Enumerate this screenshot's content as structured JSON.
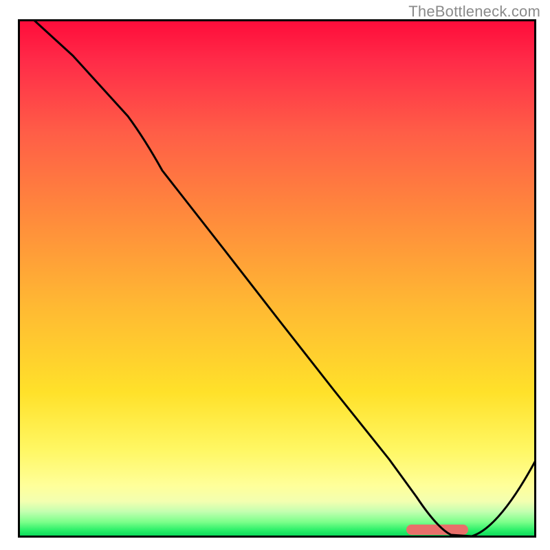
{
  "watermark": "TheBottleneck.com",
  "chart_data": {
    "type": "line",
    "title": "",
    "xlabel": "",
    "ylabel": "",
    "xlim": [
      0,
      100
    ],
    "ylim": [
      0,
      100
    ],
    "series": [
      {
        "name": "curve",
        "x": [
          3,
          10,
          20,
          25,
          30,
          40,
          50,
          60,
          70,
          75,
          80,
          83,
          87,
          100
        ],
        "values": [
          100,
          93,
          82,
          76,
          70,
          56,
          43,
          30,
          17,
          10,
          2,
          0,
          0,
          17
        ]
      }
    ],
    "optimal_band": {
      "x_start": 76,
      "x_end": 87
    },
    "gradient_bands": [
      {
        "label": "top-red",
        "color_start": "#ff1744",
        "color_end": "#ff8a50"
      },
      {
        "label": "mid-orange",
        "color_start": "#ff8a50",
        "color_end": "#ffe600"
      },
      {
        "label": "low-yellow",
        "color_start": "#ffe600",
        "color_end": "#ffff9a"
      },
      {
        "label": "green",
        "color_start": "#6cff77",
        "color_end": "#00d455"
      }
    ]
  }
}
